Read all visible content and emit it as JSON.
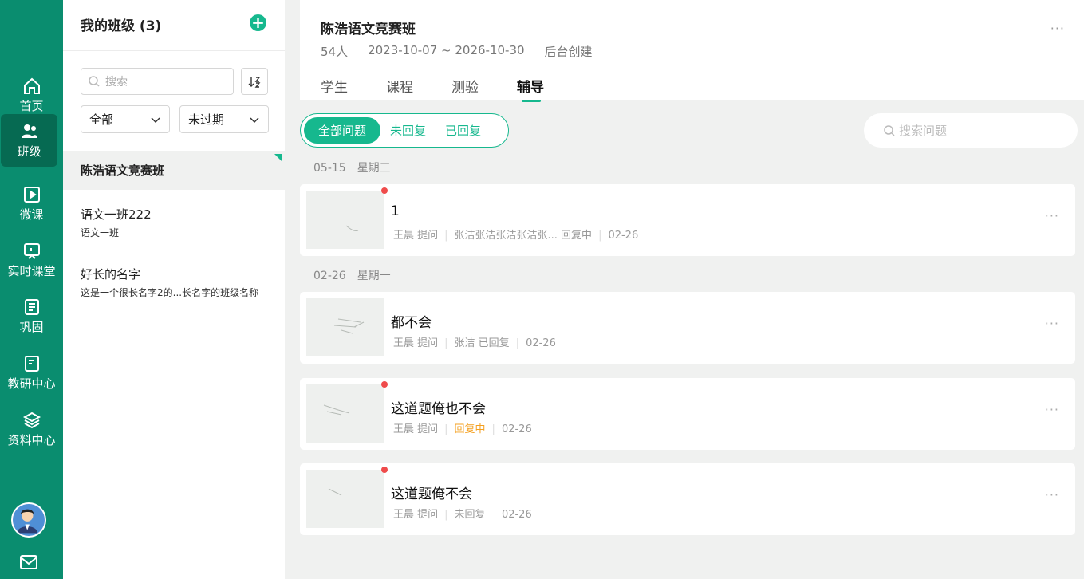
{
  "nav": {
    "items": [
      {
        "label": "首页",
        "icon": "home-icon"
      },
      {
        "label": "班级",
        "icon": "class-icon"
      },
      {
        "label": "微课",
        "icon": "microlesson-icon"
      },
      {
        "label": "实时课堂",
        "icon": "live-class-icon"
      },
      {
        "label": "巩固",
        "icon": "practice-icon"
      },
      {
        "label": "教研中心",
        "icon": "research-icon"
      },
      {
        "label": "资料中心",
        "icon": "materials-icon"
      }
    ],
    "active_index": 1
  },
  "class_list": {
    "title": "我的班级 (3)",
    "search_placeholder": "搜索",
    "filter_scope": "全部",
    "filter_status": "未过期",
    "classes": [
      {
        "name": "陈浩语文竞赛班",
        "sub": ""
      },
      {
        "name": "语文一班222",
        "sub": "语文一班"
      },
      {
        "name": "好长的名字",
        "sub": "这是一个很长名字2的...长名字的班级名称"
      }
    ]
  },
  "header": {
    "title": "陈浩语文竞赛班",
    "student_count": "54人",
    "date_range": "2023-10-07 ~ 2026-10-30",
    "source": "后台创建",
    "more": "···",
    "tabs": [
      "学生",
      "课程",
      "测验",
      "辅导"
    ],
    "active_tab": 3
  },
  "filter": {
    "all": "全部问题",
    "unanswered": "未回复",
    "answered": "已回复",
    "search_placeholder": "搜索问题"
  },
  "groups": [
    {
      "date": "05-15",
      "weekday": "星期三"
    },
    {
      "date": "02-26",
      "weekday": "星期一"
    }
  ],
  "questions": [
    {
      "title": "1",
      "asker": "王晨 提问",
      "status": "张洁张洁张洁张洁张... 回复中",
      "date": "02-26"
    },
    {
      "title": "都不会",
      "asker": "王晨 提问",
      "status": "张洁 已回复",
      "date": "02-26"
    },
    {
      "title": "这道题俺也不会",
      "asker": "王晨 提问",
      "status": "回复中",
      "date": "02-26"
    },
    {
      "title": "这道题俺不会",
      "asker": "王晨 提问",
      "status": "未回复",
      "date": "02-26"
    }
  ],
  "colors": {
    "brand": "#0a8d6f",
    "accent": "#16b88e",
    "unread_dot": "#ef4b4b",
    "pending": "#f4a020"
  }
}
